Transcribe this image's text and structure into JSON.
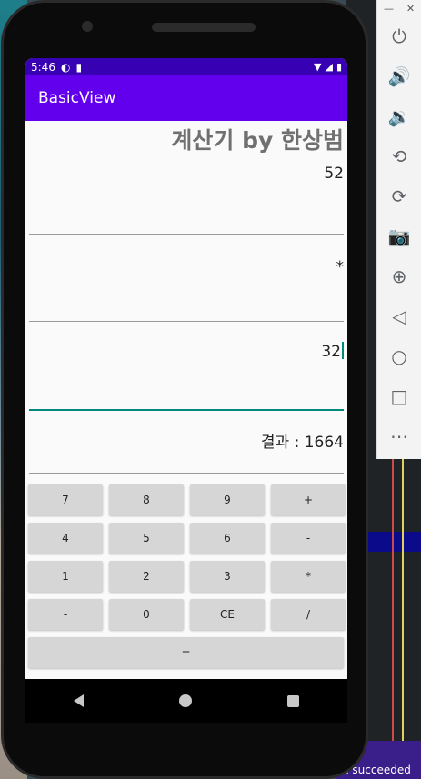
{
  "status_bar": {
    "time": "5:46"
  },
  "app_bar": {
    "title": "BasicView"
  },
  "calculator": {
    "heading": "계산기 by 한상범",
    "operand1": "52",
    "operator": "*",
    "operand2": "32",
    "result": "결과 : 1664"
  },
  "keypad": {
    "keys": [
      [
        "7",
        "8",
        "9",
        "+"
      ],
      [
        "4",
        "5",
        "6",
        "-"
      ],
      [
        "1",
        "2",
        "3",
        "*"
      ],
      [
        "-",
        "0",
        "CE",
        "/"
      ]
    ],
    "equals": "="
  },
  "emulator_toolbar": {
    "icons": [
      "power-icon",
      "volume-up-icon",
      "volume-down-icon",
      "rotate-left-icon",
      "rotate-right-icon",
      "camera-icon",
      "zoom-icon",
      "back-icon",
      "home-icon",
      "overview-icon",
      "more-icon"
    ]
  },
  "ide": {
    "status_text": "n succeeded"
  }
}
